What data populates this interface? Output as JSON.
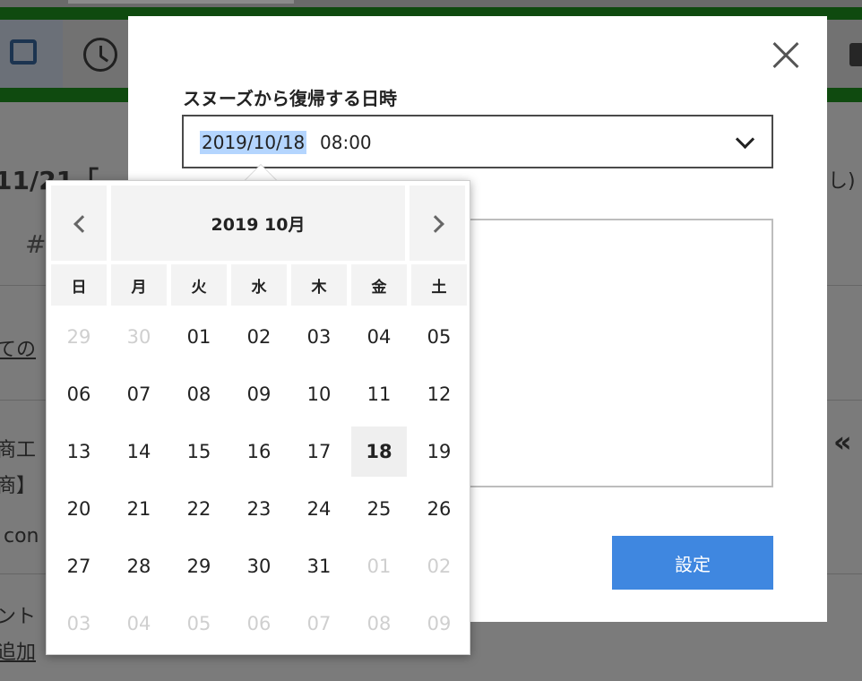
{
  "modal": {
    "label": "スヌーズから復帰する日時",
    "date_value": "2019/10/18",
    "time_value": "08:00",
    "submit_label": "設定"
  },
  "calendar": {
    "title": "2019 10月",
    "weekdays": [
      "日",
      "月",
      "火",
      "水",
      "木",
      "金",
      "土"
    ],
    "weeks": [
      [
        {
          "d": "29",
          "m": true
        },
        {
          "d": "30",
          "m": true
        },
        {
          "d": "01"
        },
        {
          "d": "02"
        },
        {
          "d": "03"
        },
        {
          "d": "04"
        },
        {
          "d": "05"
        }
      ],
      [
        {
          "d": "06"
        },
        {
          "d": "07"
        },
        {
          "d": "08"
        },
        {
          "d": "09"
        },
        {
          "d": "10"
        },
        {
          "d": "11"
        },
        {
          "d": "12"
        }
      ],
      [
        {
          "d": "13"
        },
        {
          "d": "14"
        },
        {
          "d": "15"
        },
        {
          "d": "16"
        },
        {
          "d": "17"
        },
        {
          "d": "18",
          "sel": true
        },
        {
          "d": "19"
        }
      ],
      [
        {
          "d": "20"
        },
        {
          "d": "21"
        },
        {
          "d": "22"
        },
        {
          "d": "23"
        },
        {
          "d": "24"
        },
        {
          "d": "25"
        },
        {
          "d": "26"
        }
      ],
      [
        {
          "d": "27"
        },
        {
          "d": "28"
        },
        {
          "d": "29"
        },
        {
          "d": "30"
        },
        {
          "d": "31"
        },
        {
          "d": "01",
          "m": true
        },
        {
          "d": "02",
          "m": true
        }
      ],
      [
        {
          "d": "03",
          "m": true
        },
        {
          "d": "04",
          "m": true
        },
        {
          "d": "05",
          "m": true
        },
        {
          "d": "06",
          "m": true
        },
        {
          "d": "07",
          "m": true
        },
        {
          "d": "08",
          "m": true
        },
        {
          "d": "09",
          "m": true
        }
      ]
    ]
  },
  "background": {
    "heading_left": "11/21「",
    "heading_right": "し)",
    "hash": "#",
    "link_fragment": "ての",
    "row1": "商工",
    "row2": "商】",
    "row3": "con",
    "row4": "ント",
    "row5": "追加",
    "right_arrows": "«"
  },
  "colors": {
    "accent_button": "#3f87e0",
    "selection_highlight": "#b4d5fe",
    "app_green": "#0f4a0f"
  }
}
